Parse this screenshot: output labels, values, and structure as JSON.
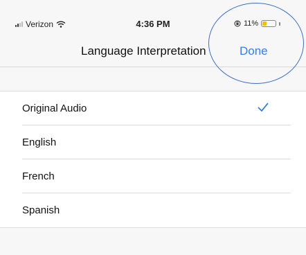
{
  "status_bar": {
    "carrier": "Verizon",
    "time": "4:36 PM",
    "battery_percent_text": "11%",
    "battery_level": 0.11,
    "icons": [
      "signal-icon",
      "wifi-icon",
      "rotation-lock-icon",
      "battery-icon"
    ]
  },
  "nav": {
    "title": "Language Interpretation",
    "done_label": "Done"
  },
  "languages": [
    {
      "label": "Original Audio",
      "selected": true
    },
    {
      "label": "English",
      "selected": false
    },
    {
      "label": "French",
      "selected": false
    },
    {
      "label": "Spanish",
      "selected": false
    }
  ],
  "colors": {
    "accent": "#2f80ed",
    "annotation": "#3a6ec1",
    "battery": "#f2c200"
  }
}
